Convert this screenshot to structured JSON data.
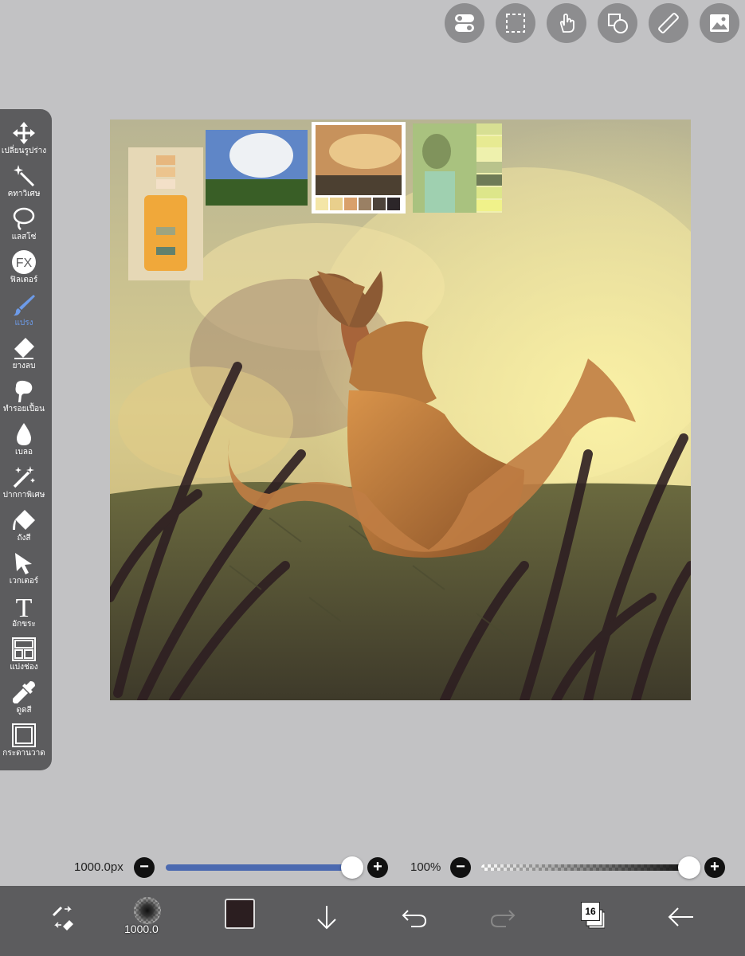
{
  "top_toolbar": [
    {
      "name": "toggle-icon"
    },
    {
      "name": "selection-icon"
    },
    {
      "name": "gesture-icon"
    },
    {
      "name": "shapes-icon"
    },
    {
      "name": "ruler-icon"
    },
    {
      "name": "gallery-icon"
    }
  ],
  "tools": [
    {
      "label": "เปลี่ยนรูปร่าง",
      "icon": "move-icon"
    },
    {
      "label": "คทาวิเศษ",
      "icon": "magic-wand-icon"
    },
    {
      "label": "แลสโซ่",
      "icon": "lasso-icon"
    },
    {
      "label": "ฟิลเตอร์",
      "icon": "filter-icon",
      "icon_text": "FX"
    },
    {
      "label": "แปรง",
      "icon": "brush-icon",
      "active": true
    },
    {
      "label": "ยางลบ",
      "icon": "eraser-icon"
    },
    {
      "label": "ทำรอยเปื้อน",
      "icon": "smudge-icon"
    },
    {
      "label": "เบลอ",
      "icon": "blur-icon"
    },
    {
      "label": "ปากกาพิเศษ",
      "icon": "special-pen-icon"
    },
    {
      "label": "ถังสี",
      "icon": "bucket-icon"
    },
    {
      "label": "เวกเตอร์",
      "icon": "vector-icon"
    },
    {
      "label": "อักขระ",
      "icon": "text-icon",
      "icon_text": "T"
    },
    {
      "label": "แบ่งช่อง",
      "icon": "frame-divider-icon"
    },
    {
      "label": "ดูดสี",
      "icon": "eyedropper-icon"
    },
    {
      "label": "กระดานวาด",
      "icon": "canvas-icon"
    }
  ],
  "brush_size": {
    "value_label": "1000.0px",
    "level": 1.0
  },
  "opacity": {
    "value_label": "100%",
    "level": 1.0
  },
  "bottom_bar": {
    "brush_size_label": "1000.0",
    "current_color": "#2b1e20",
    "layer_count": "16"
  },
  "colors": {
    "accent": "#6d9be9",
    "panel": "#5c5c5e",
    "background": "#c2c2c4"
  }
}
